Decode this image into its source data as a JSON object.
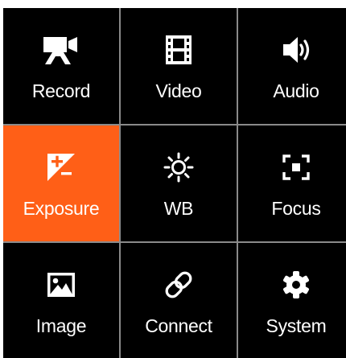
{
  "menu": {
    "selected_index": 3,
    "colors": {
      "tile_background": "#000000",
      "selected_background": "#ff5f17",
      "grid_lines": "#8a8a8a",
      "foreground": "#ffffff"
    },
    "items": [
      {
        "label": "Record",
        "icon": "movie-camera-icon"
      },
      {
        "label": "Video",
        "icon": "film-strip-icon"
      },
      {
        "label": "Audio",
        "icon": "speaker-icon"
      },
      {
        "label": "Exposure",
        "icon": "exposure-compensation-icon"
      },
      {
        "label": "WB",
        "icon": "sun-icon"
      },
      {
        "label": "Focus",
        "icon": "focus-frame-icon"
      },
      {
        "label": "Image",
        "icon": "picture-icon"
      },
      {
        "label": "Connect",
        "icon": "link-icon"
      },
      {
        "label": "System",
        "icon": "gear-icon"
      }
    ]
  }
}
